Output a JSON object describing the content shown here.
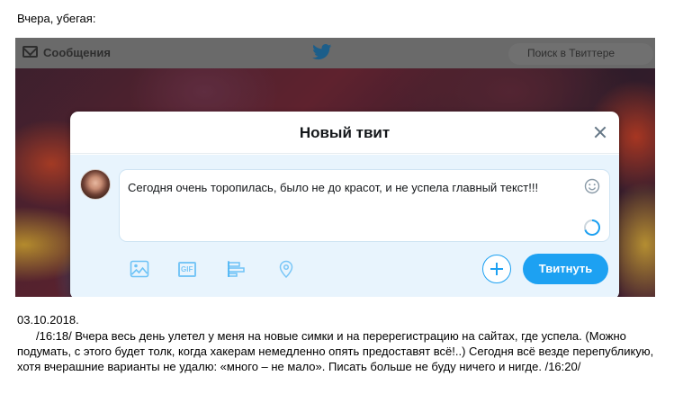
{
  "intro": "Вчера, убегая:",
  "twitter": {
    "topbar": {
      "messages_label": "Сообщения",
      "search_placeholder": "Поиск в Твиттере",
      "icons": [
        "envelope-icon",
        "twitter-bird-icon"
      ]
    },
    "dialog": {
      "title": "Новый твит",
      "tweet_text": "Сегодня очень торопилась, было не до красот, и не успела главный текст!!!",
      "tweet_button": "Твитнуть",
      "gif_label": "GIF",
      "toolbar_icons": [
        "image-icon",
        "gif-icon",
        "poll-icon",
        "location-icon"
      ]
    },
    "colors": {
      "accent": "#1da1f2",
      "title_text": "#14171a",
      "compose_background": "#e8f4fd"
    }
  },
  "diary": {
    "date": "03.10.2018.",
    "text": "/16:18/ Вчера весь день улетел у меня на новые симки и на перерегистрацию на сайтах, где успела. (Можно подумать, с этого будет толк, когда хакерам немедленно опять предоставят всё!..) Сегодня всё везде перепубликую, хотя вчерашние варианты не удалю: «много – не мало». Писать больше не буду ничего и нигде. /16:20/"
  }
}
